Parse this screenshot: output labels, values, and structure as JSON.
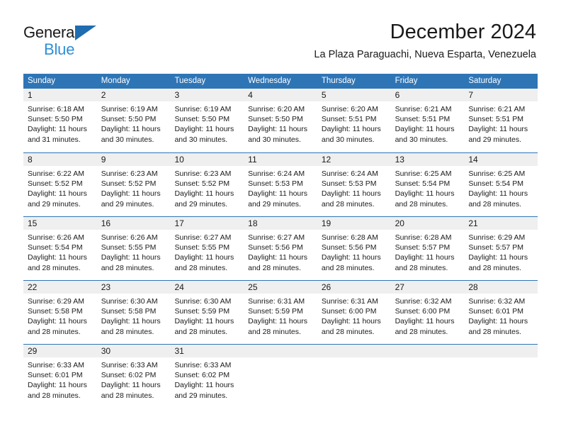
{
  "brand": {
    "name_part1": "General",
    "name_part2": "Blue",
    "logo_icon": "triangle-logo-icon"
  },
  "header": {
    "title": "December 2024",
    "subtitle": "La Plaza Paraguachi, Nueva Esparta, Venezuela"
  },
  "colors": {
    "header_blue": "#2e75b6",
    "brand_blue": "#2e8fd6",
    "logo_blue": "#1f6cb0",
    "day_band_gray": "#efefef",
    "text": "#1a1a1a"
  },
  "weekdays": [
    "Sunday",
    "Monday",
    "Tuesday",
    "Wednesday",
    "Thursday",
    "Friday",
    "Saturday"
  ],
  "weeks": [
    [
      {
        "day": "1",
        "sunrise": "Sunrise: 6:18 AM",
        "sunset": "Sunset: 5:50 PM",
        "daylight1": "Daylight: 11 hours",
        "daylight2": "and 31 minutes."
      },
      {
        "day": "2",
        "sunrise": "Sunrise: 6:19 AM",
        "sunset": "Sunset: 5:50 PM",
        "daylight1": "Daylight: 11 hours",
        "daylight2": "and 30 minutes."
      },
      {
        "day": "3",
        "sunrise": "Sunrise: 6:19 AM",
        "sunset": "Sunset: 5:50 PM",
        "daylight1": "Daylight: 11 hours",
        "daylight2": "and 30 minutes."
      },
      {
        "day": "4",
        "sunrise": "Sunrise: 6:20 AM",
        "sunset": "Sunset: 5:50 PM",
        "daylight1": "Daylight: 11 hours",
        "daylight2": "and 30 minutes."
      },
      {
        "day": "5",
        "sunrise": "Sunrise: 6:20 AM",
        "sunset": "Sunset: 5:51 PM",
        "daylight1": "Daylight: 11 hours",
        "daylight2": "and 30 minutes."
      },
      {
        "day": "6",
        "sunrise": "Sunrise: 6:21 AM",
        "sunset": "Sunset: 5:51 PM",
        "daylight1": "Daylight: 11 hours",
        "daylight2": "and 30 minutes."
      },
      {
        "day": "7",
        "sunrise": "Sunrise: 6:21 AM",
        "sunset": "Sunset: 5:51 PM",
        "daylight1": "Daylight: 11 hours",
        "daylight2": "and 29 minutes."
      }
    ],
    [
      {
        "day": "8",
        "sunrise": "Sunrise: 6:22 AM",
        "sunset": "Sunset: 5:52 PM",
        "daylight1": "Daylight: 11 hours",
        "daylight2": "and 29 minutes."
      },
      {
        "day": "9",
        "sunrise": "Sunrise: 6:23 AM",
        "sunset": "Sunset: 5:52 PM",
        "daylight1": "Daylight: 11 hours",
        "daylight2": "and 29 minutes."
      },
      {
        "day": "10",
        "sunrise": "Sunrise: 6:23 AM",
        "sunset": "Sunset: 5:52 PM",
        "daylight1": "Daylight: 11 hours",
        "daylight2": "and 29 minutes."
      },
      {
        "day": "11",
        "sunrise": "Sunrise: 6:24 AM",
        "sunset": "Sunset: 5:53 PM",
        "daylight1": "Daylight: 11 hours",
        "daylight2": "and 29 minutes."
      },
      {
        "day": "12",
        "sunrise": "Sunrise: 6:24 AM",
        "sunset": "Sunset: 5:53 PM",
        "daylight1": "Daylight: 11 hours",
        "daylight2": "and 28 minutes."
      },
      {
        "day": "13",
        "sunrise": "Sunrise: 6:25 AM",
        "sunset": "Sunset: 5:54 PM",
        "daylight1": "Daylight: 11 hours",
        "daylight2": "and 28 minutes."
      },
      {
        "day": "14",
        "sunrise": "Sunrise: 6:25 AM",
        "sunset": "Sunset: 5:54 PM",
        "daylight1": "Daylight: 11 hours",
        "daylight2": "and 28 minutes."
      }
    ],
    [
      {
        "day": "15",
        "sunrise": "Sunrise: 6:26 AM",
        "sunset": "Sunset: 5:54 PM",
        "daylight1": "Daylight: 11 hours",
        "daylight2": "and 28 minutes."
      },
      {
        "day": "16",
        "sunrise": "Sunrise: 6:26 AM",
        "sunset": "Sunset: 5:55 PM",
        "daylight1": "Daylight: 11 hours",
        "daylight2": "and 28 minutes."
      },
      {
        "day": "17",
        "sunrise": "Sunrise: 6:27 AM",
        "sunset": "Sunset: 5:55 PM",
        "daylight1": "Daylight: 11 hours",
        "daylight2": "and 28 minutes."
      },
      {
        "day": "18",
        "sunrise": "Sunrise: 6:27 AM",
        "sunset": "Sunset: 5:56 PM",
        "daylight1": "Daylight: 11 hours",
        "daylight2": "and 28 minutes."
      },
      {
        "day": "19",
        "sunrise": "Sunrise: 6:28 AM",
        "sunset": "Sunset: 5:56 PM",
        "daylight1": "Daylight: 11 hours",
        "daylight2": "and 28 minutes."
      },
      {
        "day": "20",
        "sunrise": "Sunrise: 6:28 AM",
        "sunset": "Sunset: 5:57 PM",
        "daylight1": "Daylight: 11 hours",
        "daylight2": "and 28 minutes."
      },
      {
        "day": "21",
        "sunrise": "Sunrise: 6:29 AM",
        "sunset": "Sunset: 5:57 PM",
        "daylight1": "Daylight: 11 hours",
        "daylight2": "and 28 minutes."
      }
    ],
    [
      {
        "day": "22",
        "sunrise": "Sunrise: 6:29 AM",
        "sunset": "Sunset: 5:58 PM",
        "daylight1": "Daylight: 11 hours",
        "daylight2": "and 28 minutes."
      },
      {
        "day": "23",
        "sunrise": "Sunrise: 6:30 AM",
        "sunset": "Sunset: 5:58 PM",
        "daylight1": "Daylight: 11 hours",
        "daylight2": "and 28 minutes."
      },
      {
        "day": "24",
        "sunrise": "Sunrise: 6:30 AM",
        "sunset": "Sunset: 5:59 PM",
        "daylight1": "Daylight: 11 hours",
        "daylight2": "and 28 minutes."
      },
      {
        "day": "25",
        "sunrise": "Sunrise: 6:31 AM",
        "sunset": "Sunset: 5:59 PM",
        "daylight1": "Daylight: 11 hours",
        "daylight2": "and 28 minutes."
      },
      {
        "day": "26",
        "sunrise": "Sunrise: 6:31 AM",
        "sunset": "Sunset: 6:00 PM",
        "daylight1": "Daylight: 11 hours",
        "daylight2": "and 28 minutes."
      },
      {
        "day": "27",
        "sunrise": "Sunrise: 6:32 AM",
        "sunset": "Sunset: 6:00 PM",
        "daylight1": "Daylight: 11 hours",
        "daylight2": "and 28 minutes."
      },
      {
        "day": "28",
        "sunrise": "Sunrise: 6:32 AM",
        "sunset": "Sunset: 6:01 PM",
        "daylight1": "Daylight: 11 hours",
        "daylight2": "and 28 minutes."
      }
    ],
    [
      {
        "day": "29",
        "sunrise": "Sunrise: 6:33 AM",
        "sunset": "Sunset: 6:01 PM",
        "daylight1": "Daylight: 11 hours",
        "daylight2": "and 28 minutes."
      },
      {
        "day": "30",
        "sunrise": "Sunrise: 6:33 AM",
        "sunset": "Sunset: 6:02 PM",
        "daylight1": "Daylight: 11 hours",
        "daylight2": "and 28 minutes."
      },
      {
        "day": "31",
        "sunrise": "Sunrise: 6:33 AM",
        "sunset": "Sunset: 6:02 PM",
        "daylight1": "Daylight: 11 hours",
        "daylight2": "and 29 minutes."
      },
      {
        "day": "",
        "sunrise": "",
        "sunset": "",
        "daylight1": "",
        "daylight2": ""
      },
      {
        "day": "",
        "sunrise": "",
        "sunset": "",
        "daylight1": "",
        "daylight2": ""
      },
      {
        "day": "",
        "sunrise": "",
        "sunset": "",
        "daylight1": "",
        "daylight2": ""
      },
      {
        "day": "",
        "sunrise": "",
        "sunset": "",
        "daylight1": "",
        "daylight2": ""
      }
    ]
  ]
}
